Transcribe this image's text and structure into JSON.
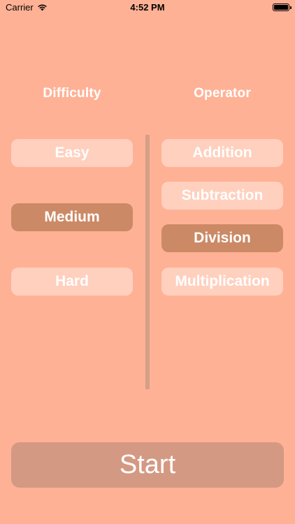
{
  "status_bar": {
    "carrier": "Carrier",
    "time": "4:52 PM"
  },
  "difficulty": {
    "header": "Difficulty",
    "options": [
      {
        "label": "Easy",
        "selected": false
      },
      {
        "label": "Medium",
        "selected": true
      },
      {
        "label": "Hard",
        "selected": false
      }
    ]
  },
  "operator": {
    "header": "Operator",
    "options": [
      {
        "label": "Addition",
        "selected": false
      },
      {
        "label": "Subtraction",
        "selected": false
      },
      {
        "label": "Division",
        "selected": true
      },
      {
        "label": "Multiplication",
        "selected": false
      }
    ]
  },
  "start_label": "Start",
  "colors": {
    "background": "#FFB195",
    "option": "#FFD0BE",
    "option_selected": "#CC8966",
    "divider": "#D69F87",
    "start_button": "#D49983"
  },
  "icons": {
    "signal": "wifi-icon",
    "battery": "battery-icon"
  }
}
